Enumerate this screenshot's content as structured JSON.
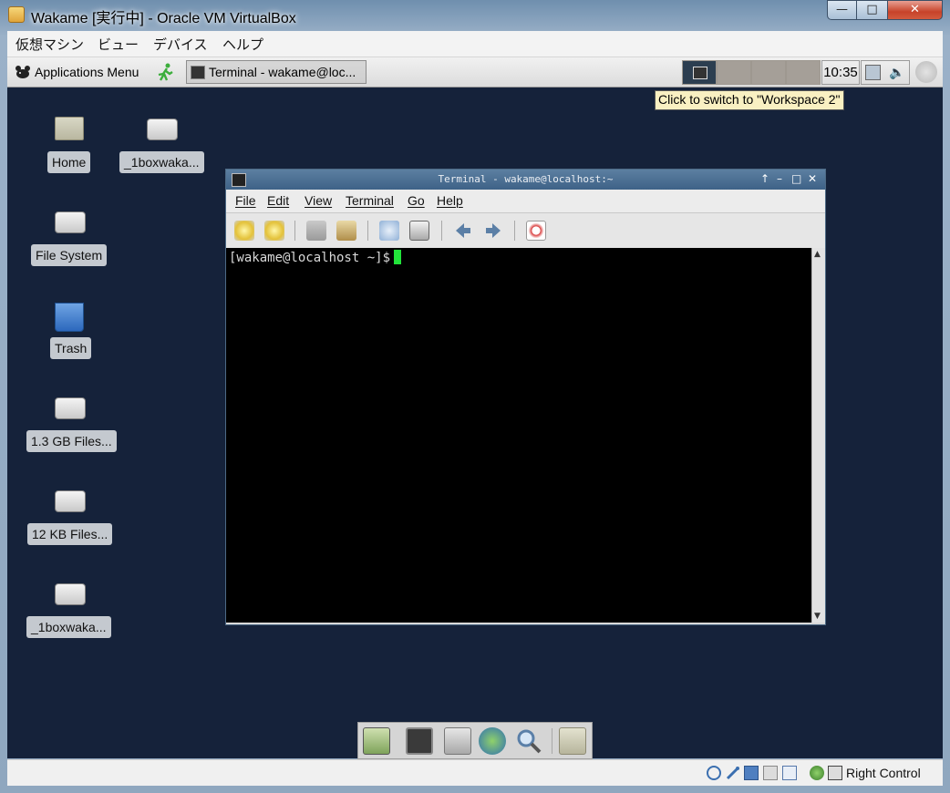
{
  "window": {
    "title": "Wakame [実行中] - Oracle VM VirtualBox",
    "minimize_glyph": "—",
    "maximize_glyph": "□",
    "close_glyph": "✕"
  },
  "vbox_menu": [
    "仮想マシン",
    "ビュー",
    "デバイス",
    "ヘルプ"
  ],
  "panel": {
    "applications_menu": "Applications Menu",
    "task_button": "Terminal - wakame@loc...",
    "clock": "10:35",
    "tooltip": "Click to switch to \"Workspace 2\""
  },
  "desktop_icons": [
    {
      "label": "Home",
      "icon": "home-folder-icon"
    },
    {
      "label": "_1boxwaka...",
      "icon": "drive-icon"
    },
    {
      "label": "File System",
      "icon": "harddisk-icon"
    },
    {
      "label": "Trash",
      "icon": "trash-icon"
    },
    {
      "label": "1.3 GB Files...",
      "icon": "drive-icon"
    },
    {
      "label": "12 KB Files...",
      "icon": "drive-icon"
    },
    {
      "label": "_1boxwaka...",
      "icon": "drive-icon"
    }
  ],
  "terminal": {
    "title": "Terminal - wakame@localhost:~",
    "menu": [
      "File",
      "Edit",
      "View",
      "Terminal",
      "Go",
      "Help"
    ],
    "prompt": "[wakame@localhost ~]$"
  },
  "statusbar": {
    "host_key": "Right Control"
  },
  "colors": {
    "desktop": "#15223a",
    "terminal_bg": "#000000",
    "cursor": "#22e33a",
    "tooltip_bg": "#f9f0c2"
  }
}
